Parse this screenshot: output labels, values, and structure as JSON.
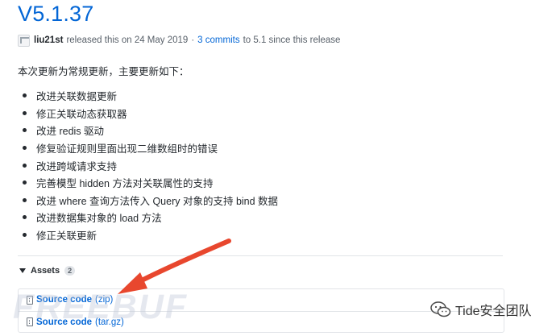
{
  "release": {
    "title": "V5.1.37",
    "author": "liu21st",
    "released_text": "released this on 24 May 2019",
    "separator": "·",
    "commits_link": "3 commits",
    "commits_suffix": "to 5.1 since this release"
  },
  "notes": {
    "summary": "本次更新为常规更新，主要更新如下：",
    "items": [
      {
        "label": "改进关联数据更新"
      },
      {
        "label": "修正关联动态获取器"
      },
      {
        "label": "改进 redis 驱动"
      },
      {
        "label": "修复验证规则里面出现二维数组时的错误"
      },
      {
        "label": "改进跨域请求支持"
      },
      {
        "label": "完善模型 hidden 方法对关联属性的支持"
      },
      {
        "label": "改进 where 查询方法传入 Query 对象的支持 bind 数据"
      },
      {
        "label": "改进数据集对象的 load 方法"
      },
      {
        "label": "修正关联更新"
      }
    ]
  },
  "assets": {
    "label": "Assets",
    "count": "2",
    "files": [
      {
        "name": "Source code",
        "format": "(zip)"
      },
      {
        "name": "Source code",
        "format": "(tar.gz)"
      }
    ]
  },
  "watermarks": {
    "freebuf": "FREEBUF",
    "wechat": "Tide安全团队"
  },
  "colors": {
    "link": "#0366d6",
    "arrow": "#e8472e"
  },
  "icons": {
    "avatar": "avatar-icon",
    "triangle": "triangle-down-icon",
    "zip": "file-zip-icon",
    "wechat": "wechat-logo-icon"
  }
}
